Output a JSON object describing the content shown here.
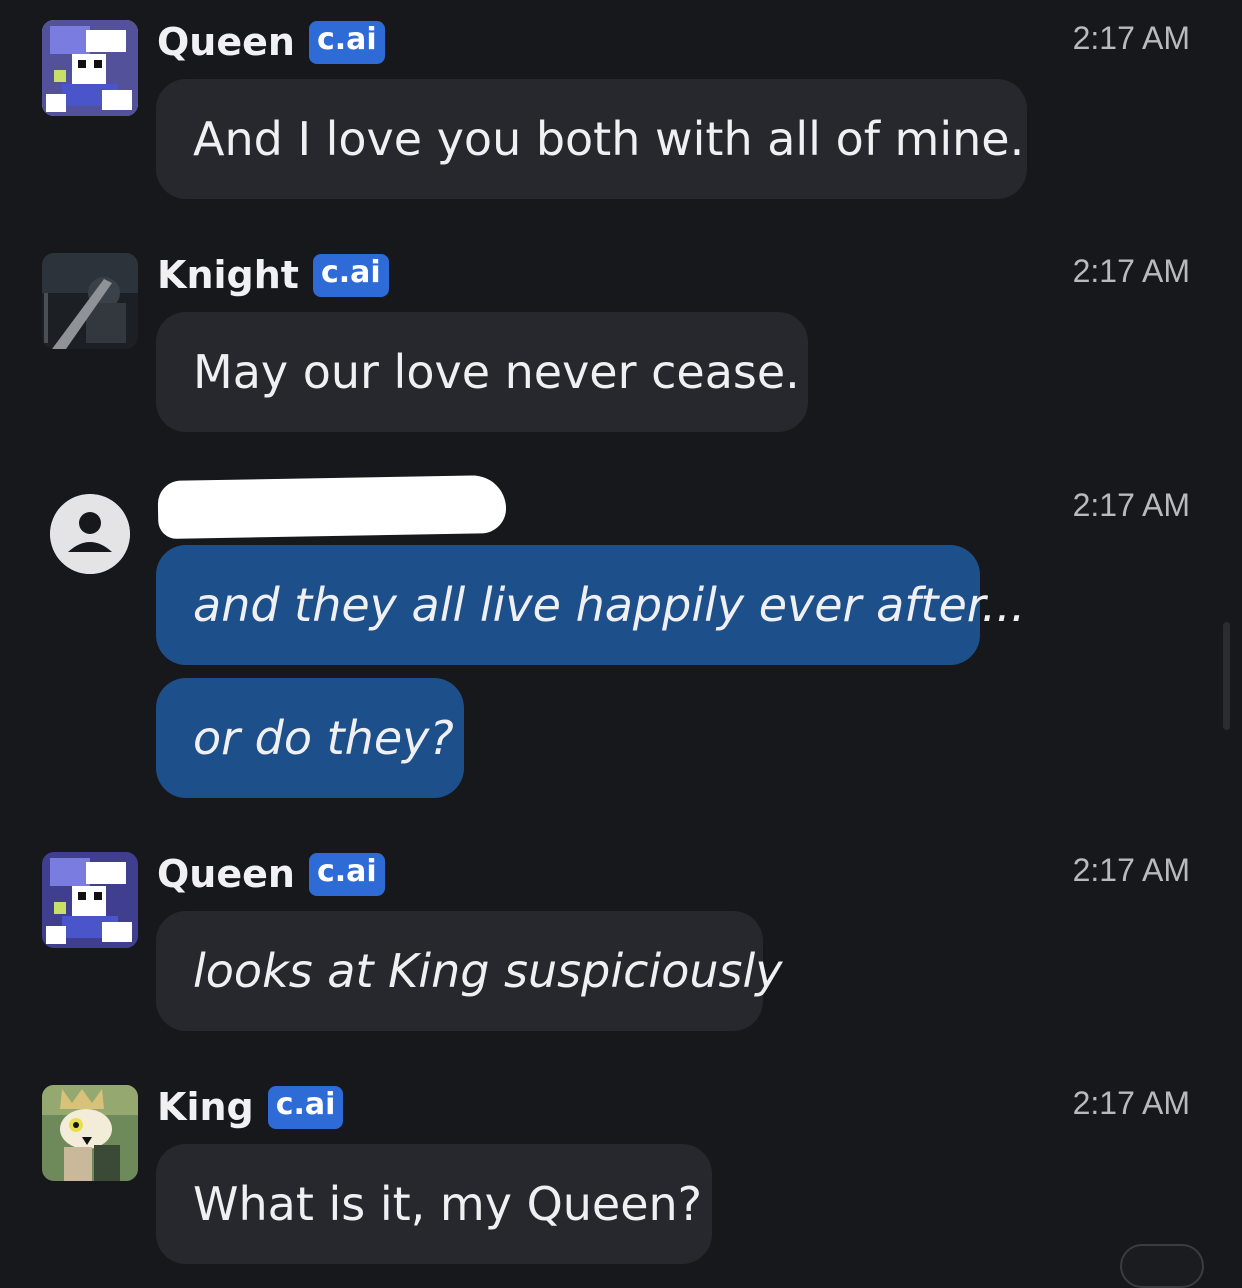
{
  "messages": [
    {
      "sender": "Queen",
      "badge": "c.ai",
      "time": "2:17 AM",
      "text": "And I love you both with all of mine."
    },
    {
      "sender": "Knight",
      "badge": "c.ai",
      "time": "2:17 AM",
      "text": "May our love never cease."
    },
    {
      "sender": "",
      "time": "2:17 AM",
      "texts": [
        "and they all live happily ever after...",
        "or do they?"
      ]
    },
    {
      "sender": "Queen",
      "badge": "c.ai",
      "time": "2:17 AM",
      "text": "looks at King suspiciously"
    },
    {
      "sender": "King",
      "badge": "c.ai",
      "time": "2:17 AM",
      "text": "What is it, my Queen?"
    }
  ],
  "colors": {
    "background": "#17181c",
    "bot_bubble": "#26282e",
    "user_bubble": "#1d4f8a",
    "badge": "#2f6bd6"
  },
  "icons": {
    "queen_avatar": "queen-avatar",
    "knight_avatar": "knight-avatar",
    "user_avatar": "user-avatar-icon",
    "king_avatar": "king-avatar"
  }
}
